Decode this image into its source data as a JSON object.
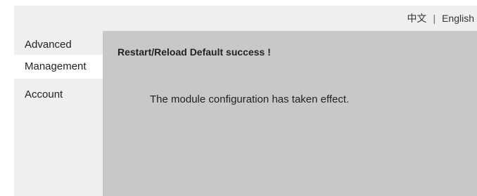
{
  "header": {
    "lang_chinese": "中文",
    "lang_separator": "|",
    "lang_english": "English"
  },
  "sidebar": {
    "items": [
      {
        "label": "Advanced"
      },
      {
        "label": "Management"
      },
      {
        "label": "Account"
      }
    ]
  },
  "main": {
    "title": "Restart/Reload Default success !",
    "message": "The module configuration has taken effect."
  },
  "colors": {
    "topbar_bg": "#efefef",
    "sidebar_bg": "#efefef",
    "sidebar_active_bg": "#ffffff",
    "content_bg": "#c8c8c8"
  }
}
